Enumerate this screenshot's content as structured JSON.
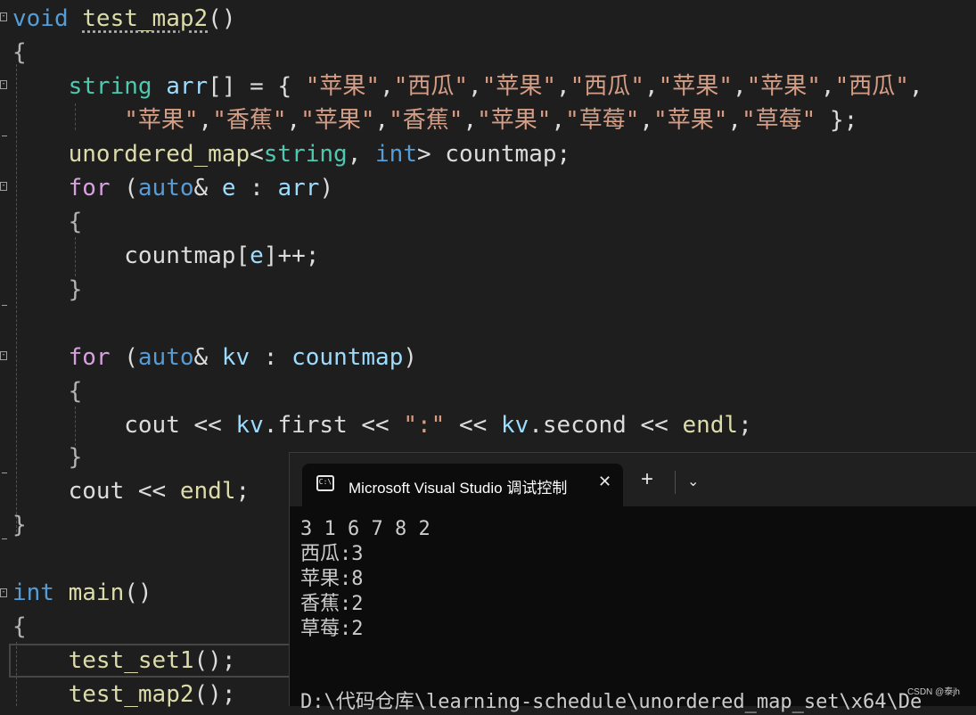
{
  "code": {
    "line1": {
      "kw": "void",
      "fn": "test_map2",
      "tail": "()"
    },
    "line2": {
      "text": "{"
    },
    "line3": {
      "type": "string",
      "var": "arr",
      "op": "[] = { ",
      "strings": [
        "\"苹果\"",
        "\"西瓜\"",
        "\"苹果\"",
        "\"西瓜\"",
        "\"苹果\"",
        "\"苹果\"",
        "\"西瓜\""
      ],
      "sep": ",",
      "trail": ","
    },
    "line4": {
      "strings": [
        "\"苹果\"",
        "\"香蕉\"",
        "\"苹果\"",
        "\"香蕉\"",
        "\"苹果\"",
        "\"草莓\"",
        "\"苹果\"",
        "\"草莓\""
      ],
      "sep": ",",
      "tail": " };"
    },
    "line5": {
      "type1": "unordered_map",
      "lt": "<",
      "type2": "string",
      "comma": ", ",
      "kw": "int",
      "gt": ">",
      "var": " countmap;"
    },
    "line6": {
      "ctl": "for",
      "open": " (",
      "kw": "auto",
      "amp": "& ",
      "e": "e",
      "colon": " : ",
      "arr": "arr",
      "close": ")"
    },
    "line7": {
      "text": "{"
    },
    "line8": {
      "var": "countmap",
      "br1": "[",
      "e": "e",
      "br2": "]",
      "tail": "++;"
    },
    "line9": {
      "text": "}"
    },
    "line11": {
      "ctl": "for",
      "open": " (",
      "kw": "auto",
      "amp": "& ",
      "kv": "kv",
      "colon": " : ",
      "cm": "countmap",
      "close": ")"
    },
    "line12": {
      "text": "{"
    },
    "line13": {
      "cout": "cout",
      "op1": " << ",
      "kv1": "kv",
      "first": ".first",
      "op2": " << ",
      "str": "\":\"",
      "op3": " << ",
      "kv2": "kv",
      "second": ".second",
      "op4": " << ",
      "endl": "endl",
      "semi": ";"
    },
    "line14": {
      "text": "}"
    },
    "line15": {
      "cout": "cout",
      "op": " << ",
      "endl": "endl",
      "semi": ";"
    },
    "line16": {
      "text": "}"
    },
    "line18": {
      "kw": "int",
      "fn": " main",
      "tail": "()"
    },
    "line19": {
      "text": "{"
    },
    "line20": {
      "fn": "test_set1",
      "tail": "();"
    },
    "line21": {
      "fn": "test_map2",
      "tail": "();"
    }
  },
  "console": {
    "tab_title": "Microsoft Visual Studio 调试控制台",
    "tab_icon": "terminal-icon",
    "close_glyph": "✕",
    "add_glyph": "+",
    "dropdown_glyph": "⌄",
    "lines": [
      "3 1 6 7 8 2",
      "西瓜:3",
      "苹果:8",
      "香蕉:2",
      "草莓:2"
    ],
    "path_line": "D:\\代码仓库\\learning-schedule\\unordered_map_set\\x64\\De"
  },
  "watermark": "CSDN @泰jh",
  "colors": {
    "background": "#1e1e1e",
    "keyword": "#569cd6",
    "control": "#d8a0df",
    "type": "#4ec9b0",
    "function": "#dcdcaa",
    "variable": "#9cdcfe",
    "string": "#d69d85",
    "console_bg": "#0c0c0c"
  }
}
